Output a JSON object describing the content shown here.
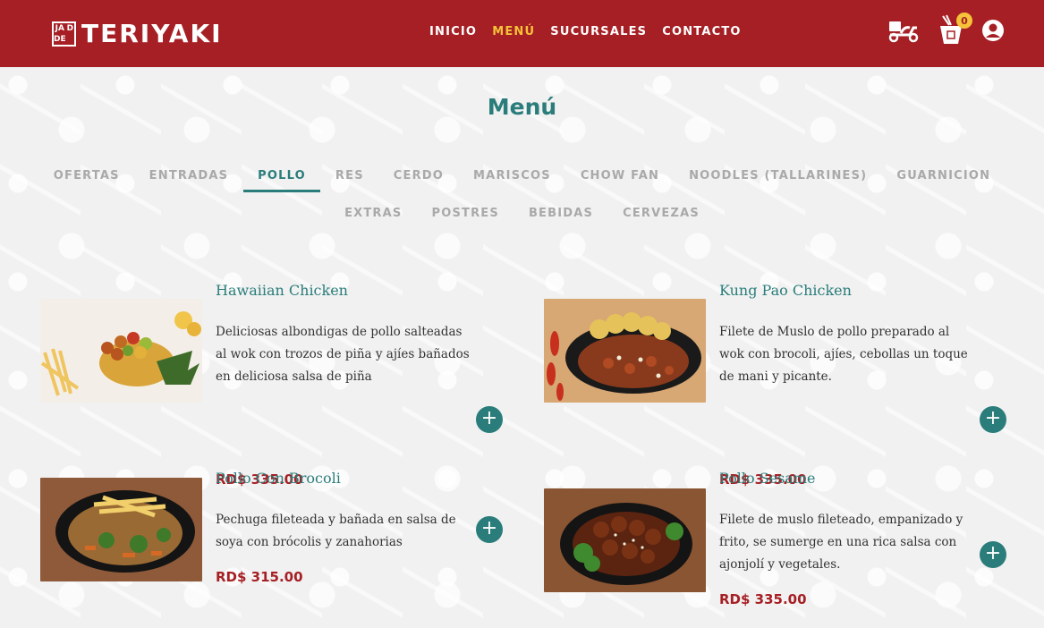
{
  "brand": {
    "logo_box": [
      "JA",
      "D",
      "DE",
      ""
    ],
    "logo_text": "TERIYAKI"
  },
  "nav": {
    "items": [
      {
        "label": "INICIO",
        "active": false
      },
      {
        "label": "MENÚ",
        "active": true
      },
      {
        "label": "SUCURSALES",
        "active": false
      },
      {
        "label": "CONTACTO",
        "active": false
      }
    ]
  },
  "header_icons": {
    "delivery": "scooter-icon",
    "cart": "takeout-box-icon",
    "cart_count": "0",
    "account": "user-icon"
  },
  "page": {
    "title": "Menú"
  },
  "categories": {
    "row1": [
      "OFERTAS",
      "ENTRADAS",
      "POLLO",
      "RES",
      "CERDO",
      "MARISCOS",
      "CHOW FAN",
      "NOODLES (TALLARINES)",
      "GUARNICION"
    ],
    "row2": [
      "EXTRAS",
      "POSTRES",
      "BEBIDAS",
      "CERVEZAS"
    ],
    "active": "POLLO"
  },
  "items": [
    {
      "name": "Hawaiian Chicken",
      "description": "Deliciosas albondigas de pollo salteadas al wok con trozos de piña y ajíes bañados en deliciosa salsa de piña",
      "price": "RD$ 335.00",
      "add": "+"
    },
    {
      "name": "Kung Pao Chicken",
      "description": "Filete de Muslo de pollo preparado al wok con brocoli, ajíes, cebollas un toque de mani y picante.",
      "price": "RD$ 335.00",
      "add": "+"
    },
    {
      "name": "Pollo Con Brocoli",
      "description": "Pechuga fileteada y bañada en salsa de soya con brócolis y zanahorias",
      "price": "RD$ 315.00",
      "add": "+"
    },
    {
      "name": "Pollo Sesame",
      "description": "Filete de muslo fileteado, empanizado y frito, se sumerge en una rica salsa con ajonjolí y vegetales.",
      "price": "RD$ 335.00",
      "add": "+"
    }
  ],
  "colors": {
    "brand_red": "#a61f24",
    "accent_yellow": "#f5c23a",
    "teal": "#2a7d7a"
  }
}
